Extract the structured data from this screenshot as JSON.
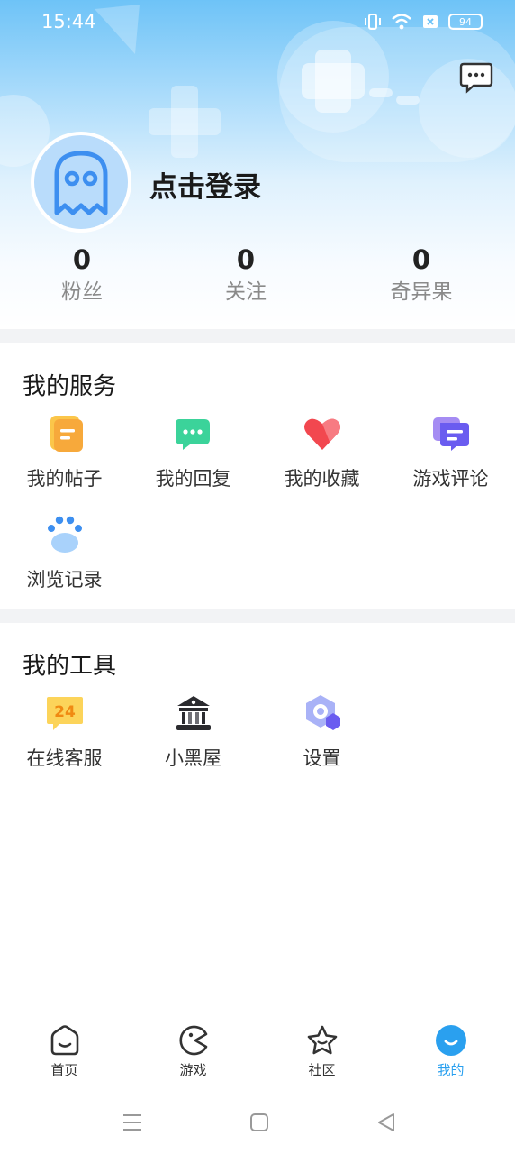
{
  "status_bar": {
    "time": "15:44",
    "battery": "94"
  },
  "profile": {
    "login_text": "点击登录"
  },
  "stats": [
    {
      "value": "0",
      "label": "粉丝"
    },
    {
      "value": "0",
      "label": "关注"
    },
    {
      "value": "0",
      "label": "奇异果"
    }
  ],
  "services": {
    "title": "我的服务",
    "items": [
      {
        "label": "我的帖子",
        "icon": "posts-icon"
      },
      {
        "label": "我的回复",
        "icon": "reply-icon"
      },
      {
        "label": "我的收藏",
        "icon": "favorite-heart-icon"
      },
      {
        "label": "游戏评论",
        "icon": "game-comment-icon"
      },
      {
        "label": "浏览记录",
        "icon": "paw-history-icon"
      }
    ]
  },
  "tools": {
    "title": "我的工具",
    "items": [
      {
        "label": "在线客服",
        "icon": "support-24-icon",
        "badge": "24"
      },
      {
        "label": "小黑屋",
        "icon": "jail-house-icon"
      },
      {
        "label": "设置",
        "icon": "settings-hex-icon"
      }
    ]
  },
  "bottom_nav": [
    {
      "label": "首页",
      "icon": "home-icon",
      "active": false
    },
    {
      "label": "游戏",
      "icon": "game-pacman-icon",
      "active": false
    },
    {
      "label": "社区",
      "icon": "community-star-icon",
      "active": false
    },
    {
      "label": "我的",
      "icon": "me-icon",
      "active": true
    }
  ],
  "colors": {
    "accent": "#2aa0ef",
    "header_top": "#6ec3f7",
    "avatar_bg": "#b9dcfb"
  }
}
